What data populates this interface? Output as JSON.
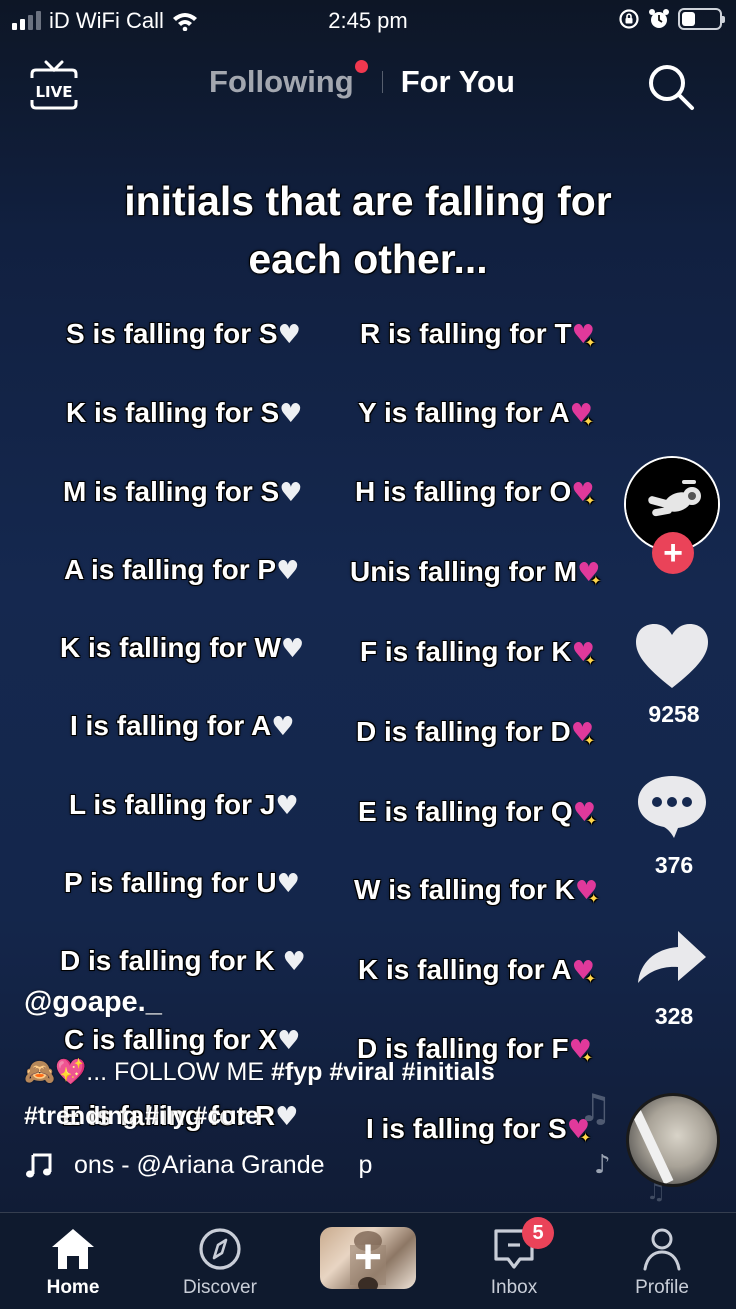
{
  "status_bar": {
    "carrier": "iD WiFi Call",
    "time": "2:45 pm",
    "signal_bars_active": 2,
    "signal_bars_total": 4,
    "battery_level": 0.35
  },
  "top_nav": {
    "live_label": "LIVE",
    "tabs": [
      {
        "label": "Following",
        "active": false,
        "has_dot": true
      },
      {
        "label": "For You",
        "active": true
      }
    ],
    "accent_color": "#f0384f"
  },
  "video": {
    "headline": "initials that are falling for each other...",
    "headline_line1": "initials that are falling for",
    "headline_line2": "each other...",
    "left_column": [
      {
        "text": "S is falling for S",
        "emoji": "white-heart"
      },
      {
        "text": "K is falling for S",
        "emoji": "white-heart"
      },
      {
        "text": "M is falling for S",
        "emoji": "white-heart"
      },
      {
        "text": "A is falling for P",
        "emoji": "white-heart"
      },
      {
        "text": "K is falling for W",
        "emoji": "white-heart"
      },
      {
        "text": "I is falling for A",
        "emoji": "white-heart"
      },
      {
        "text": "L is falling for J",
        "emoji": "white-heart"
      },
      {
        "text": "P is falling for U",
        "emoji": "white-heart"
      },
      {
        "text": "D is falling for K ",
        "emoji": "white-heart"
      },
      {
        "text": "C is falling for X",
        "emoji": "white-heart"
      },
      {
        "text": "E is falling for R",
        "emoji": "white-heart"
      }
    ],
    "right_column": [
      {
        "text": "R is falling for T",
        "emoji": "sparkling-heart"
      },
      {
        "text": "Y is falling for A",
        "emoji": "sparkling-heart"
      },
      {
        "text": "H is falling for O",
        "emoji": "sparkling-heart"
      },
      {
        "text": "Unis falling for M",
        "emoji": "sparkling-heart"
      },
      {
        "text": "F is falling for K",
        "emoji": "sparkling-heart"
      },
      {
        "text": "D is falling for D",
        "emoji": "sparkling-heart"
      },
      {
        "text": "E is falling for Q",
        "emoji": "sparkling-heart"
      },
      {
        "text": "W is falling for K",
        "emoji": "sparkling-heart"
      },
      {
        "text": "K is falling for A",
        "emoji": "sparkling-heart"
      },
      {
        "text": "D is falling for F",
        "emoji": "sparkling-heart"
      },
      {
        "text": "I is falling for S",
        "emoji": "sparkling-heart"
      }
    ],
    "white_heart_glyph": "♥",
    "pink_heart_glyph": "♥",
    "sparkle_glyph": "✦"
  },
  "right_rail": {
    "follow_glyph": "+",
    "likes": "9258",
    "comments": "376",
    "shares": "328"
  },
  "caption": {
    "username": "@goape._",
    "emoji_prefix": "🙈💖",
    "text": "... FOLLOW ME ",
    "hashtags_line1": [
      "#fyp",
      "#viral",
      "#initials"
    ],
    "hashtags_line2": [
      "#trending",
      "#ily",
      "#cute"
    ],
    "sound": "ons - @Ariana Grande",
    "sound_trailing": "p"
  },
  "bottom_nav": {
    "items": [
      {
        "label": "Home",
        "active": true
      },
      {
        "label": "Discover",
        "active": false
      },
      {
        "label": "",
        "create": true
      },
      {
        "label": "Inbox",
        "active": false,
        "badge": "5"
      },
      {
        "label": "Profile",
        "active": false
      }
    ],
    "create_glyph": "+",
    "badge_color": "#ea4359"
  }
}
